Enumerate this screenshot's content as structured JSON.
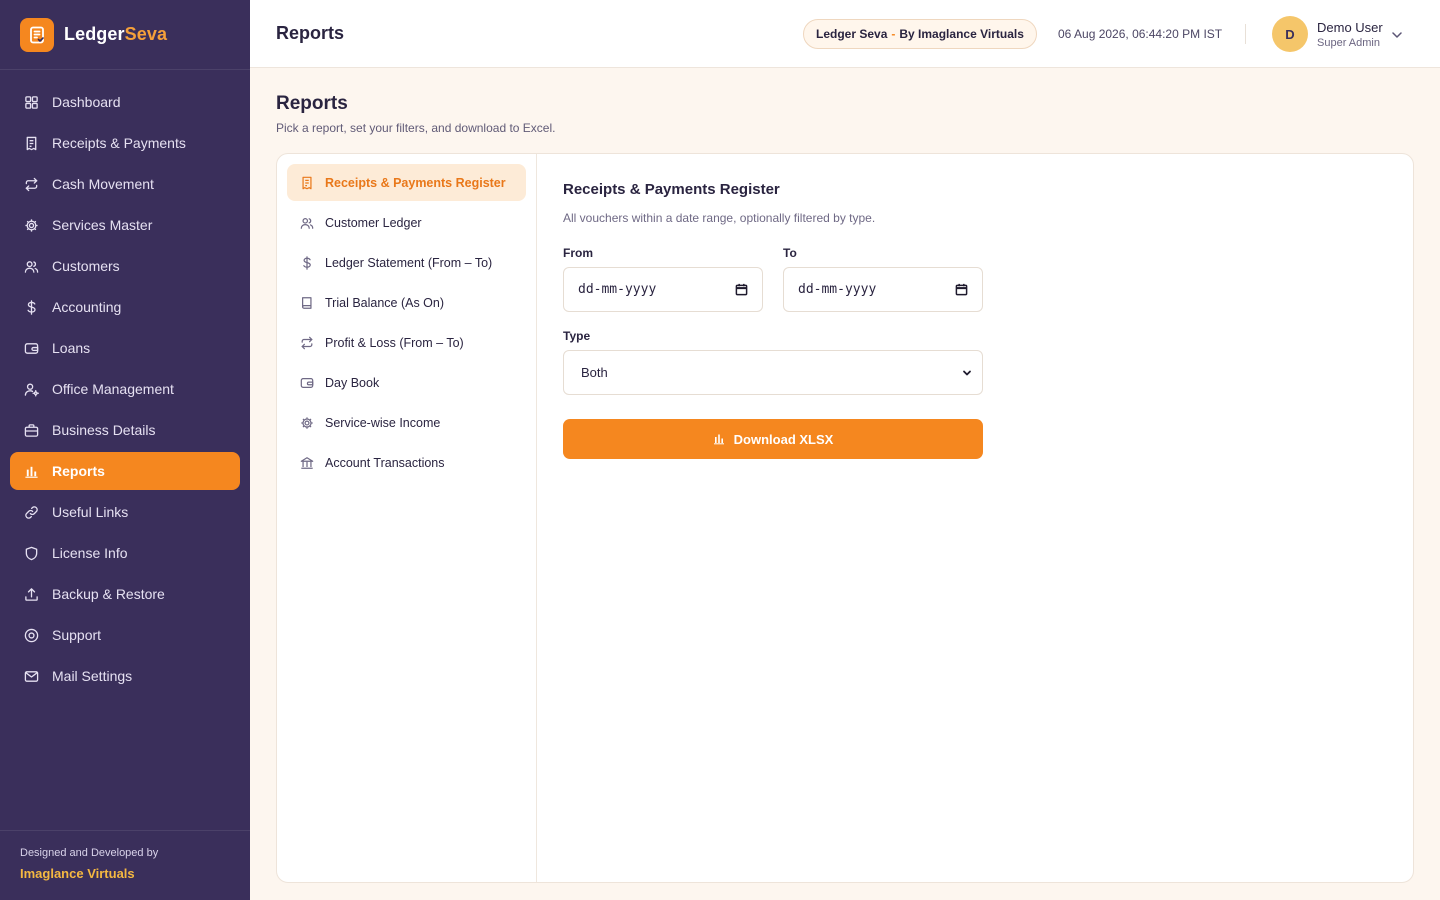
{
  "brand": {
    "name_main": "Ledger",
    "name_accent": "Seva"
  },
  "sidebar": {
    "items": [
      {
        "label": "Dashboard",
        "icon": "grid-icon"
      },
      {
        "label": "Receipts & Payments",
        "icon": "receipt-icon"
      },
      {
        "label": "Cash Movement",
        "icon": "repeat-icon"
      },
      {
        "label": "Services Master",
        "icon": "gear-icon"
      },
      {
        "label": "Customers",
        "icon": "users-icon"
      },
      {
        "label": "Accounting",
        "icon": "dollar-icon"
      },
      {
        "label": "Loans",
        "icon": "wallet-icon"
      },
      {
        "label": "Office Management",
        "icon": "user-cog-icon"
      },
      {
        "label": "Business Details",
        "icon": "briefcase-icon"
      },
      {
        "label": "Reports",
        "icon": "bar-chart-icon",
        "active": true
      },
      {
        "label": "Useful Links",
        "icon": "link-icon"
      },
      {
        "label": "License Info",
        "icon": "shield-icon"
      },
      {
        "label": "Backup & Restore",
        "icon": "upload-icon"
      },
      {
        "label": "Support",
        "icon": "help-circle-icon"
      },
      {
        "label": "Mail Settings",
        "icon": "mail-icon"
      }
    ],
    "footer_caption": "Designed and Developed by",
    "footer_company": "Imaglance Virtuals"
  },
  "topbar": {
    "title": "Reports",
    "pill_left": "Ledger Seva",
    "pill_sep": "-",
    "pill_right": "By Imaglance Virtuals",
    "datetime": "06 Aug 2026, 06:44:20 PM IST",
    "user": {
      "initial": "D",
      "name": "Demo User",
      "role": "Super Admin"
    }
  },
  "page": {
    "title": "Reports",
    "subtitle": "Pick a report, set your filters, and download to Excel."
  },
  "reports": {
    "items": [
      {
        "label": "Receipts & Payments Register",
        "icon": "receipt-icon",
        "active": true
      },
      {
        "label": "Customer Ledger",
        "icon": "users-icon"
      },
      {
        "label": "Ledger Statement (From – To)",
        "icon": "dollar-icon"
      },
      {
        "label": "Trial Balance (As On)",
        "icon": "book-icon"
      },
      {
        "label": "Profit & Loss (From – To)",
        "icon": "repeat-icon"
      },
      {
        "label": "Day Book",
        "icon": "wallet-icon"
      },
      {
        "label": "Service-wise Income",
        "icon": "gear-icon"
      },
      {
        "label": "Account Transactions",
        "icon": "bank-icon"
      }
    ]
  },
  "form": {
    "title": "Receipts & Payments Register",
    "description": "All vouchers within a date range, optionally filtered by type.",
    "from_label": "From",
    "from_placeholder": "dd-mm-yyyy",
    "to_label": "To",
    "to_placeholder": "dd-mm-yyyy",
    "type_label": "Type",
    "type_value": "Both",
    "download_label": "Download XLSX"
  },
  "colors": {
    "sidebar": "#3a2f5b",
    "accent": "#f5871f",
    "page_bg": "#fdf6ef",
    "company_gold": "#f5b841"
  }
}
